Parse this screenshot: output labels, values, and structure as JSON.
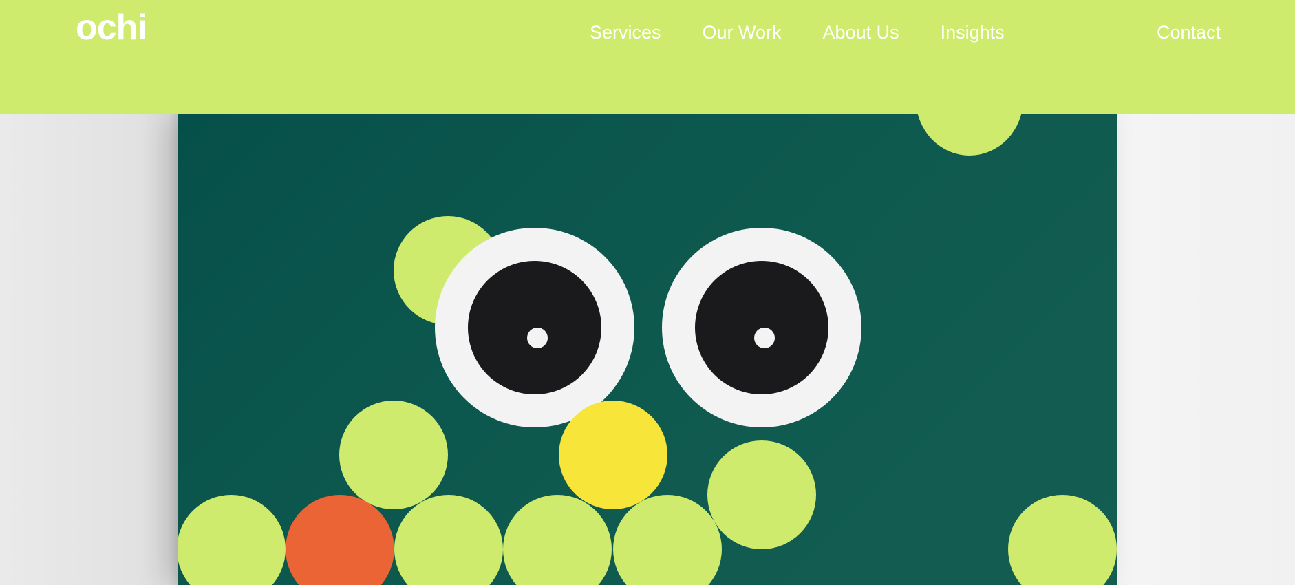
{
  "header": {
    "logo": "ochi",
    "nav": [
      {
        "label": "Services"
      },
      {
        "label": "Our Work"
      },
      {
        "label": "About Us"
      },
      {
        "label": "Insights"
      }
    ],
    "contact": "Contact"
  },
  "colors": {
    "header_bg": "#cfeb6d",
    "card_bg": "#0b544c",
    "accent_green": "#cfeb6d",
    "accent_orange": "#eb6435",
    "accent_yellow": "#f7e53a"
  }
}
